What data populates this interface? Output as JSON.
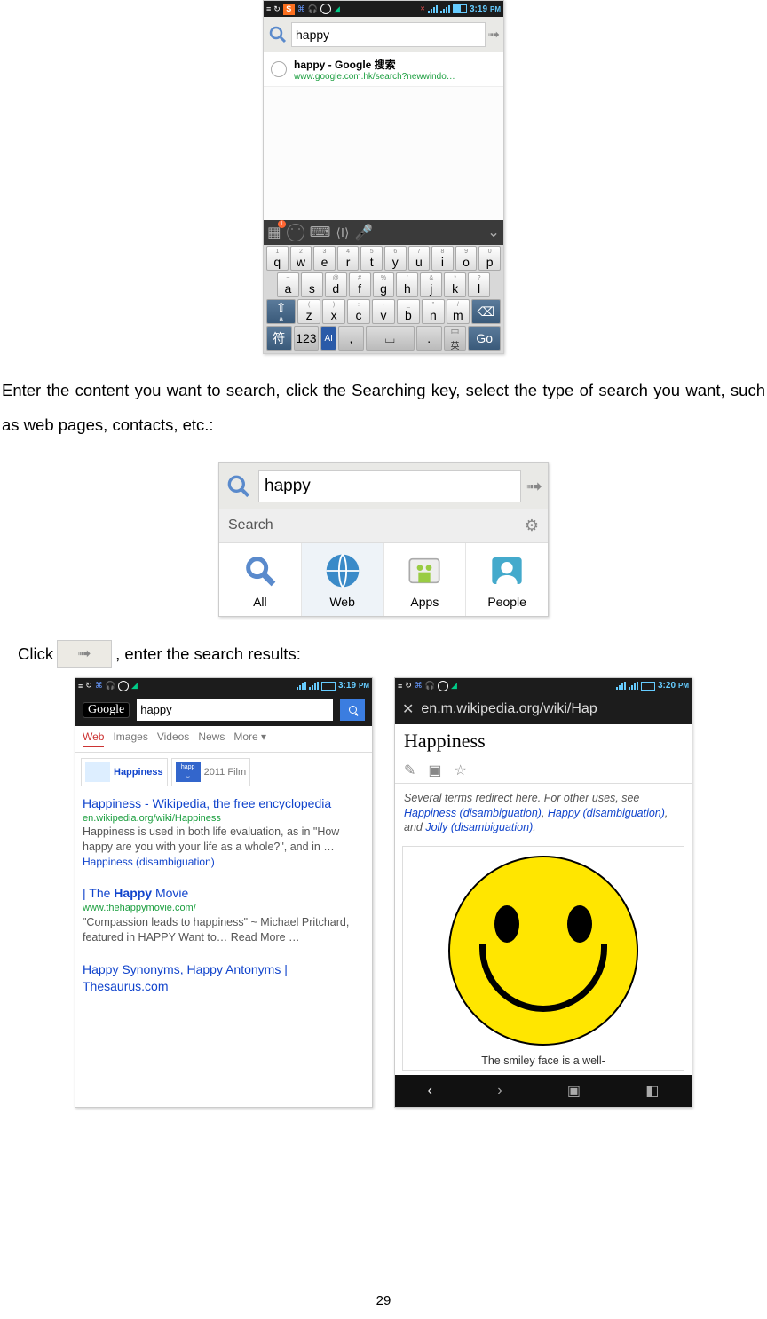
{
  "status": {
    "time": "3:19",
    "pm": "PM",
    "time2": "3:20"
  },
  "screen1": {
    "search_value": "happy",
    "sugg_title": "happy - Google 搜索",
    "sugg_url": "www.google.com.hk/search?newwindo…",
    "keys_r1": [
      [
        "1",
        "q"
      ],
      [
        "2",
        "w"
      ],
      [
        "3",
        "e"
      ],
      [
        "4",
        "r"
      ],
      [
        "5",
        "t"
      ],
      [
        "6",
        "y"
      ],
      [
        "7",
        "u"
      ],
      [
        "8",
        "i"
      ],
      [
        "9",
        "o"
      ],
      [
        "0",
        "p"
      ]
    ],
    "keys_r2": [
      [
        "~",
        "a"
      ],
      [
        "!",
        "s"
      ],
      [
        "@",
        "d"
      ],
      [
        "#",
        "f"
      ],
      [
        "%",
        "g"
      ],
      [
        "'",
        "h"
      ],
      [
        "&",
        "j"
      ],
      [
        "*",
        "k"
      ],
      [
        "?",
        "l"
      ]
    ],
    "keys_r3": [
      [
        "(",
        "z"
      ],
      [
        ")",
        "x"
      ],
      [
        ":",
        "c"
      ],
      [
        "-",
        "v"
      ],
      [
        "_",
        "b"
      ],
      [
        "\"",
        "n"
      ],
      [
        "/",
        "m"
      ]
    ],
    "fu": "符",
    "num": "123",
    "zh": "中",
    "en": "英",
    "go": "Go"
  },
  "para1": "Enter the content you want to search, click the Searching key, select the type of search you want, such as web pages, contacts, etc.:",
  "screen2": {
    "search_value": "happy",
    "search_label": "Search",
    "tabs": [
      "All",
      "Web",
      "Apps",
      "People"
    ]
  },
  "line3a": "Click ",
  "line3b": ", enter the search results:",
  "screen3": {
    "input": "happy",
    "tabs": [
      "Web",
      "Images",
      "Videos",
      "News",
      "More ▾"
    ],
    "card1": "Happiness",
    "card2": "2011 Film",
    "r1t": "Happiness - Wikipedia, the free encyclopedia",
    "r1u": "en.wikipedia.org/wiki/Happiness",
    "r1d": "Happiness is used in both life evaluation, as in \"How happy are you with your life as a whole?\", and in …",
    "r1l": "Happiness (disambiguation)",
    "r2t": "| The Happy Movie",
    "r2u": "www.thehappymovie.com/",
    "r2d": "\"Compassion leads to happiness\" ~ Michael Pritchard, featured in HAPPY Want to… Read More …",
    "r3t": "Happy Synonyms, Happy Antonyms | Thesaurus.com"
  },
  "screen4": {
    "url": "en.m.wikipedia.org/wiki/Hap",
    "title": "Happiness",
    "note1": "Several terms redirect here. For other uses, see ",
    "note2": "Happiness (disambiguation)",
    "note3": ", ",
    "note4": "Happy (disambiguation)",
    "note5": ", and ",
    "note6": "Jolly (disambiguation)",
    "note7": ".",
    "caption": "The smiley face is a well-"
  },
  "pageno": "29"
}
